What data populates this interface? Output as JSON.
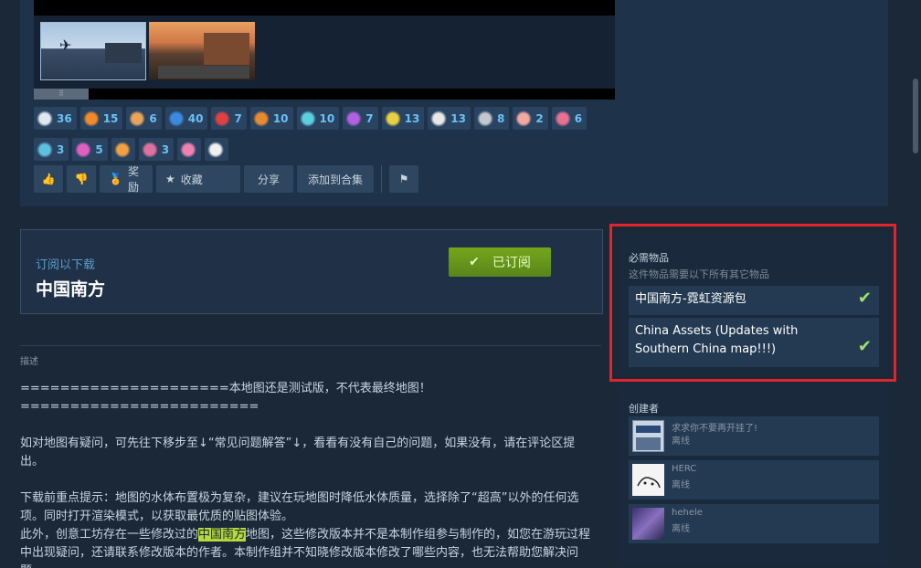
{
  "media": {
    "scroll_grip": "⠿"
  },
  "awards": [
    {
      "icon": "eagle-award-icon",
      "color": "#dfe8f0",
      "count": "36"
    },
    {
      "icon": "pointing-hand-award-icon",
      "color": "#f08a2a",
      "count": "15"
    },
    {
      "icon": "cookie-award-icon",
      "color": "#e9a35a",
      "count": "6"
    },
    {
      "icon": "gift-award-icon",
      "color": "#3a8be0",
      "count": "40"
    },
    {
      "icon": "can-award-icon",
      "color": "#e04040",
      "count": "7"
    },
    {
      "icon": "fox-award-icon",
      "color": "#e88a30",
      "count": "10"
    },
    {
      "icon": "rocket-award-icon",
      "color": "#5ad0e0",
      "count": "10"
    },
    {
      "icon": "heart-hands-award-icon",
      "color": "#b060e0",
      "count": "7"
    },
    {
      "icon": "sun-award-icon",
      "color": "#e8d040",
      "count": "13"
    },
    {
      "icon": "skeleton-award-icon",
      "color": "#e8e8e8",
      "count": "13"
    },
    {
      "icon": "cloud-award-icon",
      "color": "#c0c8d0",
      "count": "8"
    },
    {
      "icon": "brain-award-icon",
      "color": "#f0a8a0",
      "count": "2"
    },
    {
      "icon": "pig-award-icon",
      "color": "#e87090",
      "count": "6"
    },
    {
      "icon": "bird-award-icon",
      "color": "#60c0e0",
      "count": "3"
    },
    {
      "icon": "fish-award-icon",
      "color": "#e060c0",
      "count": "5"
    },
    {
      "icon": "hand-award-icon",
      "color": "#f0a040",
      "count": ""
    },
    {
      "icon": "hippo-award-icon",
      "color": "#e070a0",
      "count": "3"
    },
    {
      "icon": "heart-award-icon",
      "color": "#f080b0",
      "count": ""
    },
    {
      "icon": "chicken-award-icon",
      "color": "#f0f0f0",
      "count": ""
    }
  ],
  "actions": {
    "award_label": "奖励",
    "favorite_label": "收藏",
    "share_label": "分享",
    "add_collection_label": "添加到合集"
  },
  "subscribe": {
    "label": "订阅以下载",
    "title": "中国南方",
    "button_label": "已订阅"
  },
  "description": {
    "label": "描述",
    "line1": "=====================本地图还是测试版，不代表最终地图！========================",
    "para2": "如对地图有疑问，可先往下移步至↓“常见问题解答”↓，看看有没有自己的问题，如果没有，请在评论区提出。",
    "para3": "下载前重点提示：地图的水体布置极为复杂，建议在玩地图时降低水体质量，选择除了“超高”以外的任何选项。同时打开渲染模式，以获取最优质的贴图体验。",
    "para4_pre": "此外，创意工坊存在一些修改过的",
    "para4_hl": "中国南方",
    "para4_post": "地图，这些修改版本并不是本制作组参与制作的，如您在游玩过程中出现疑问，还请联系修改版本的作者。本制作组并不知晓修改版本修改了哪些内容，也无法帮助您解决问题。"
  },
  "required": {
    "title": "必需物品",
    "subtitle": "这件物品需要以下所有其它物品",
    "items": [
      {
        "label": "中国南方-霓虹资源包"
      },
      {
        "label": "China Assets (Updates with Southern China map!!!)"
      }
    ],
    "highlight_color": "#e0252c"
  },
  "creators": {
    "title": "创建者",
    "items": [
      {
        "name": "求求你不要再开挂了!",
        "status": "离线"
      },
      {
        "name": "HERC",
        "status": "离线"
      },
      {
        "name": "hehele",
        "status": "离线"
      }
    ]
  }
}
